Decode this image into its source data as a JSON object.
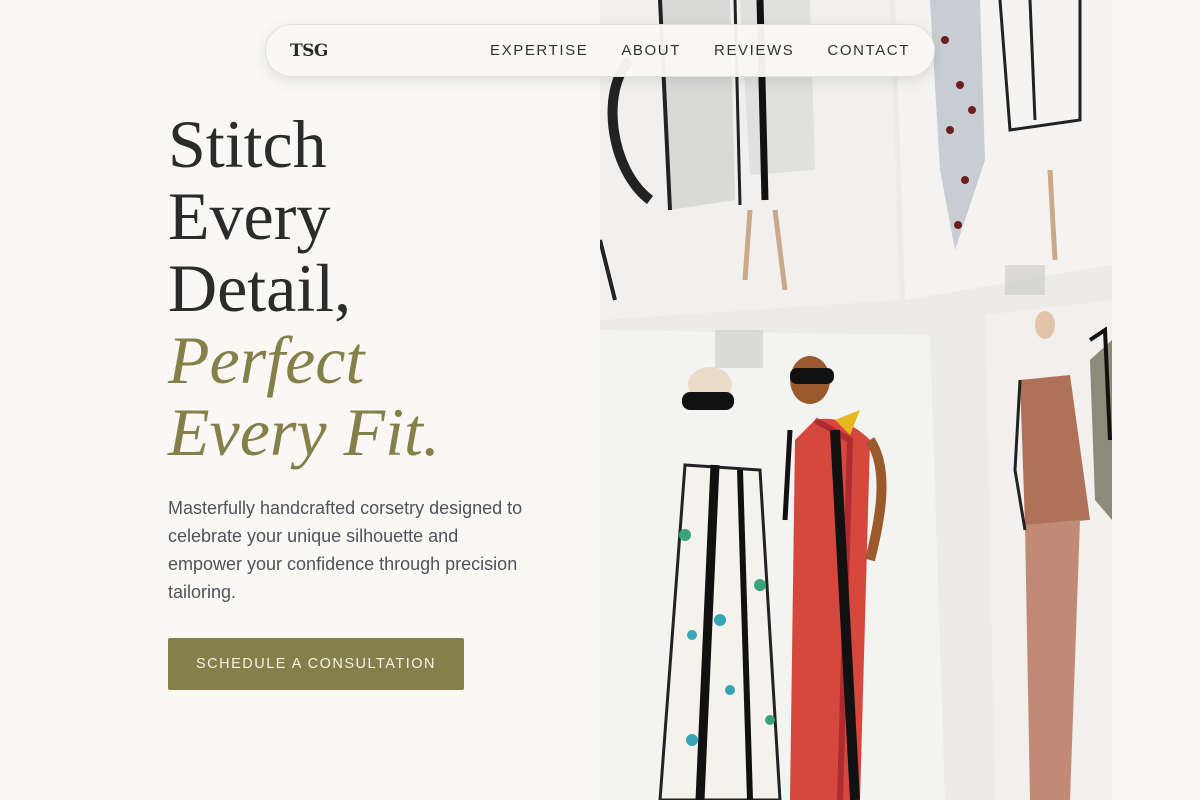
{
  "nav": {
    "logo": "TSG",
    "links": [
      "EXPERTISE",
      "ABOUT",
      "REVIEWS",
      "CONTACT"
    ]
  },
  "hero": {
    "headline_lines": [
      "Stitch",
      "Every",
      "Detail,"
    ],
    "accent_lines": [
      "Perfect",
      "Every Fit."
    ],
    "subtext": "Masterfully handcrafted corsetry designed to celebrate your unique silhouette and empower your confidence through precision tailoring.",
    "cta_label": "SCHEDULE A CONSULTATION",
    "image_alt": "Watercolor fashion sketches pinned to a studio wall"
  },
  "colors": {
    "background": "#f9f8f4",
    "accent": "#857f4a",
    "text_dark": "#2b2b2b",
    "text_body": "#4f535b"
  }
}
